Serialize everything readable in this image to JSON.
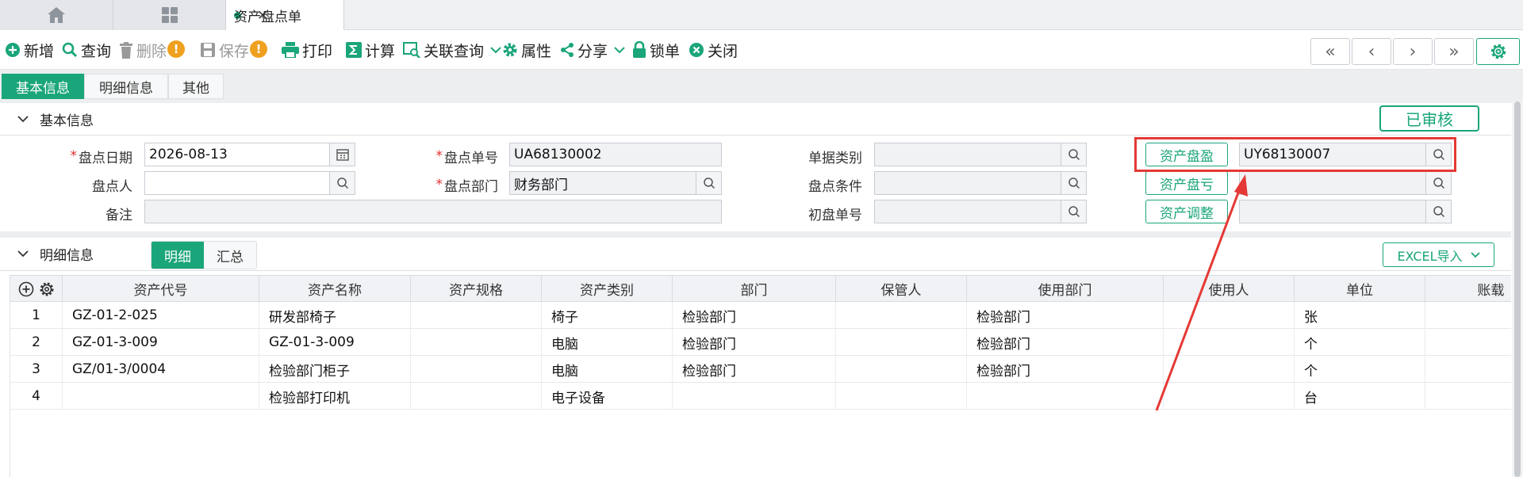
{
  "tabs": {
    "doc_title": "资产盘点单",
    "close_glyph": "✕"
  },
  "toolbar": {
    "new": "新增",
    "query": "查询",
    "delete": "删除",
    "save": "保存",
    "print": "打印",
    "calc": "计算",
    "related": "关联查询",
    "attrs": "属性",
    "share": "分享",
    "lock": "锁单",
    "close": "关闭",
    "warn_glyph": "!"
  },
  "nav": {
    "first": "«",
    "prev": "‹",
    "next": "›",
    "last": "»"
  },
  "section_tabs": [
    "基本信息",
    "明细信息",
    "其他"
  ],
  "basic": {
    "title": "基本信息",
    "status": "已审核",
    "labels": {
      "date": "盘点日期",
      "no": "盘点单号",
      "type": "单据类别",
      "person": "盘点人",
      "dept": "盘点部门",
      "cond": "盘点条件",
      "remark": "备注",
      "initial": "初盘单号"
    },
    "values": {
      "date": "2026-08-13",
      "no": "UA68130002",
      "type": "",
      "person": "",
      "dept": "财务部门",
      "cond": "",
      "remark": "",
      "initial": "",
      "surplus_no": "UY68130007",
      "loss_no": "",
      "adjust_no": ""
    },
    "buttons": {
      "surplus": "资产盘盈",
      "loss": "资产盘亏",
      "adjust": "资产调整"
    }
  },
  "detail": {
    "title": "明细信息",
    "subtabs": [
      "明细",
      "汇总"
    ],
    "excel_btn": "EXCEL导入",
    "columns": [
      "资产代号",
      "资产名称",
      "资产规格",
      "资产类别",
      "部门",
      "保管人",
      "使用部门",
      "使用人",
      "单位",
      "账载"
    ],
    "rows": [
      {
        "n": "1",
        "code": "GZ-01-2-025",
        "name": "研发部椅子",
        "spec": "",
        "cat": "椅子",
        "dept": "检验部门",
        "keeper": "",
        "use_dept": "检验部门",
        "user": "",
        "unit": "张"
      },
      {
        "n": "2",
        "code": "GZ-01-3-009",
        "name": "GZ-01-3-009",
        "spec": "",
        "cat": "电脑",
        "dept": "检验部门",
        "keeper": "",
        "use_dept": "检验部门",
        "user": "",
        "unit": "个"
      },
      {
        "n": "3",
        "code": "GZ/01-3/0004",
        "name": "检验部门柜子",
        "spec": "",
        "cat": "电脑",
        "dept": "检验部门",
        "keeper": "",
        "use_dept": "检验部门",
        "user": "",
        "unit": "个"
      },
      {
        "n": "4",
        "code": "",
        "name": "检验部打印机",
        "spec": "",
        "cat": "电子设备",
        "dept": "",
        "keeper": "",
        "use_dept": "",
        "user": "",
        "unit": "台"
      }
    ]
  },
  "colors": {
    "accent": "#1aa57a",
    "annotation": "#e53935",
    "required": "#e03030",
    "warning": "#f0a020"
  }
}
